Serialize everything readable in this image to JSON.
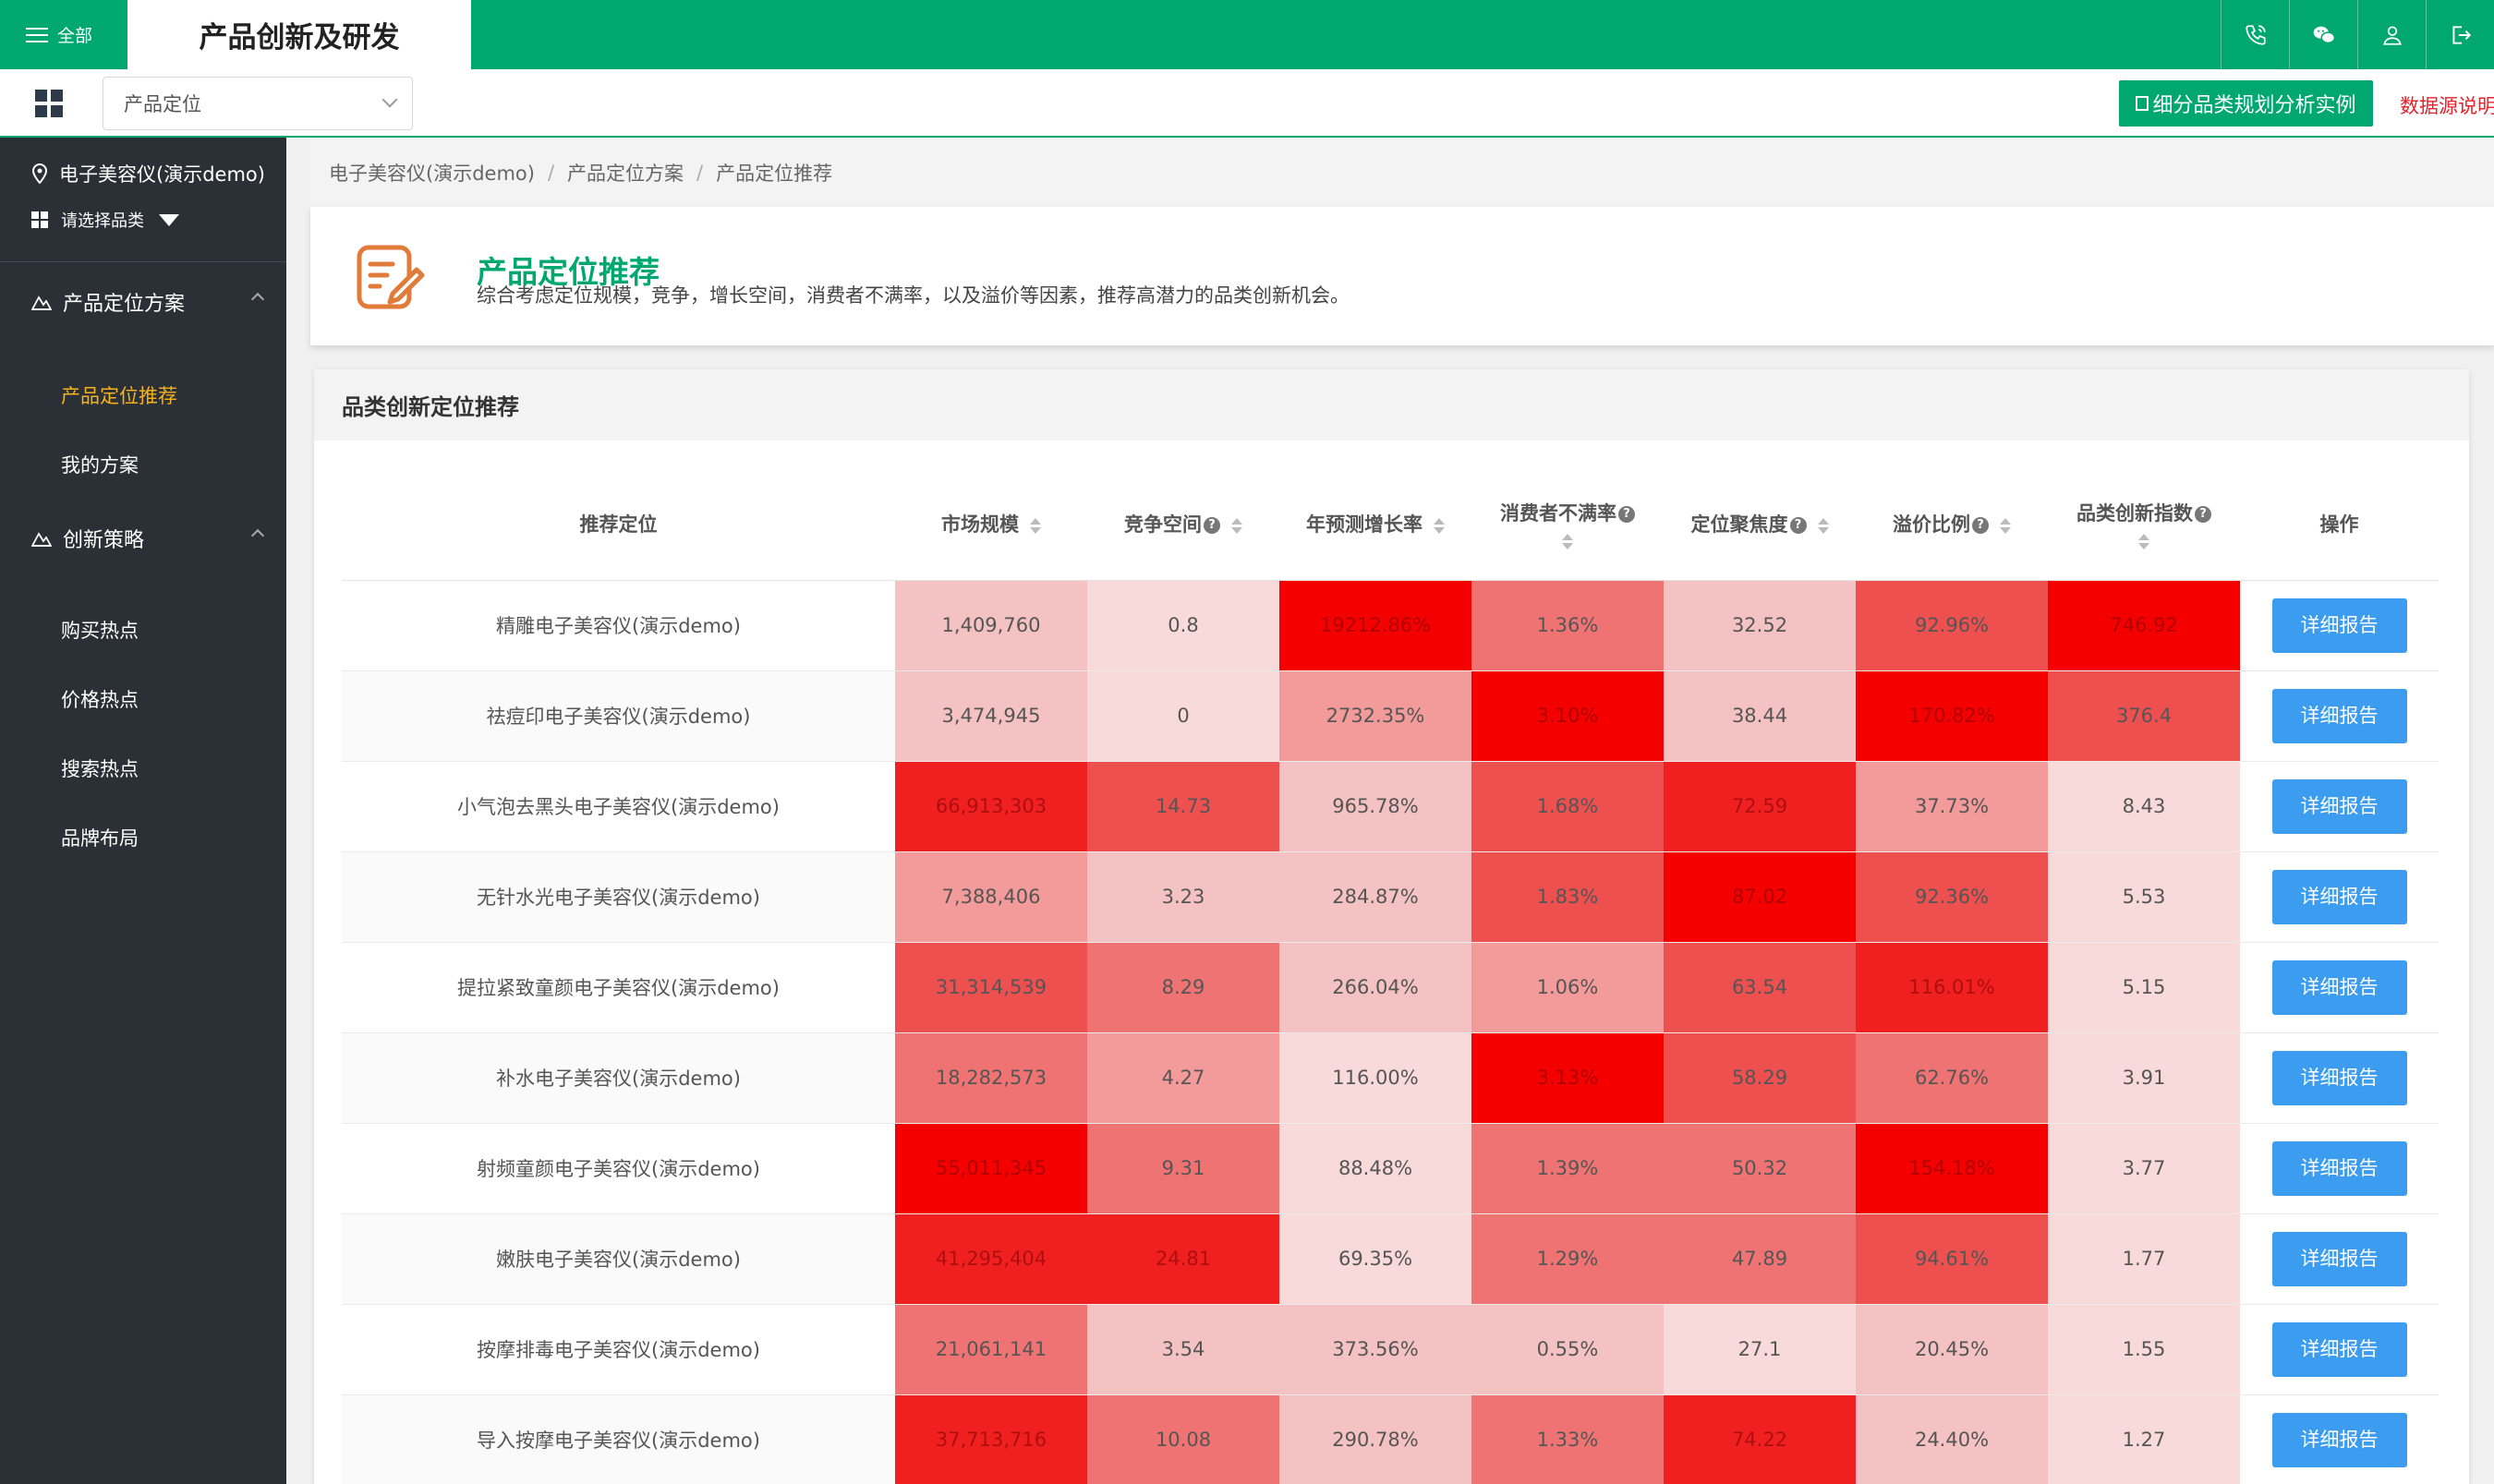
{
  "header": {
    "menu_label": "全部",
    "app_title": "产品创新及研发",
    "icons": [
      "phone-icon",
      "wechat-icon",
      "user-icon",
      "logout-icon"
    ]
  },
  "toolbar": {
    "select_value": "产品定位",
    "example_button": "细分品类规划分析实例",
    "data_source_link": "数据源说明"
  },
  "sidebar": {
    "project": "电子美容仪(演示demo)",
    "category_select": "请选择品类",
    "groups": [
      {
        "label": "产品定位方案",
        "items": [
          "产品定位推荐",
          "我的方案"
        ]
      },
      {
        "label": "创新策略",
        "items": [
          "购买热点",
          "价格热点",
          "搜索热点",
          "品牌布局"
        ]
      }
    ],
    "active_item": "产品定位推荐"
  },
  "breadcrumb": [
    "电子美容仪(演示demo)",
    "产品定位方案",
    "产品定位推荐"
  ],
  "page": {
    "title": "产品定位推荐",
    "description": "综合考虑定位规模，竞争，增长空间，消费者不满率，以及溢价等因素，推荐高潜力的品类创新机会。"
  },
  "table": {
    "card_title": "品类创新定位推荐",
    "columns": [
      "推荐定位",
      "市场规模",
      "竞争空间",
      "年预测增长率",
      "消费者不满率",
      "定位聚焦度",
      "溢价比例",
      "品类创新指数",
      "操作"
    ],
    "action_label": "详细报告",
    "colors": {
      "lightest": "#f9dada",
      "light": "#f4c2c2",
      "mid": "#f39a9a",
      "strong": "#f07373",
      "stronger": "#ee5050",
      "deep": "#f02020",
      "max": "#f40000"
    },
    "rows": [
      {
        "name": "精雕电子美容仪(演示demo)",
        "cells": [
          "1,409,760",
          "0.8",
          "19212.86%",
          "1.36%",
          "32.52",
          "92.96%",
          "746.92"
        ],
        "levels": [
          1,
          0,
          6,
          3,
          1,
          4,
          6
        ]
      },
      {
        "name": "祛痘印电子美容仪(演示demo)",
        "cells": [
          "3,474,945",
          "0",
          "2732.35%",
          "3.10%",
          "38.44",
          "170.82%",
          "376.4"
        ],
        "levels": [
          1,
          0,
          2,
          6,
          1,
          6,
          4
        ]
      },
      {
        "name": "小气泡去黑头电子美容仪(演示demo)",
        "cells": [
          "66,913,303",
          "14.73",
          "965.78%",
          "1.68%",
          "72.59",
          "37.73%",
          "8.43"
        ],
        "levels": [
          5,
          4,
          1,
          4,
          5,
          2,
          0
        ]
      },
      {
        "name": "无针水光电子美容仪(演示demo)",
        "cells": [
          "7,388,406",
          "3.23",
          "284.87%",
          "1.83%",
          "87.02",
          "92.36%",
          "5.53"
        ],
        "levels": [
          2,
          1,
          1,
          4,
          6,
          4,
          0
        ]
      },
      {
        "name": "提拉紧致童颜电子美容仪(演示demo)",
        "cells": [
          "31,314,539",
          "8.29",
          "266.04%",
          "1.06%",
          "63.54",
          "116.01%",
          "5.15"
        ],
        "levels": [
          4,
          3,
          1,
          2,
          4,
          5,
          0
        ]
      },
      {
        "name": "补水电子美容仪(演示demo)",
        "cells": [
          "18,282,573",
          "4.27",
          "116.00%",
          "3.13%",
          "58.29",
          "62.76%",
          "3.91"
        ],
        "levels": [
          3,
          2,
          0,
          6,
          4,
          3,
          0
        ]
      },
      {
        "name": "射频童颜电子美容仪(演示demo)",
        "cells": [
          "55,011,345",
          "9.31",
          "88.48%",
          "1.39%",
          "50.32",
          "154.18%",
          "3.77"
        ],
        "levels": [
          6,
          3,
          0,
          3,
          3,
          6,
          0
        ]
      },
      {
        "name": "嫩肤电子美容仪(演示demo)",
        "cells": [
          "41,295,404",
          "24.81",
          "69.35%",
          "1.29%",
          "47.89",
          "94.61%",
          "1.77"
        ],
        "levels": [
          5,
          5,
          0,
          3,
          3,
          4,
          0
        ]
      },
      {
        "name": "按摩排毒电子美容仪(演示demo)",
        "cells": [
          "21,061,141",
          "3.54",
          "373.56%",
          "0.55%",
          "27.1",
          "20.45%",
          "1.55"
        ],
        "levels": [
          3,
          1,
          1,
          1,
          0,
          1,
          0
        ]
      },
      {
        "name": "导入按摩电子美容仪(演示demo)",
        "cells": [
          "37,713,716",
          "10.08",
          "290.78%",
          "1.33%",
          "74.22",
          "24.40%",
          "1.27"
        ],
        "levels": [
          5,
          3,
          1,
          3,
          5,
          1,
          0
        ]
      }
    ]
  }
}
